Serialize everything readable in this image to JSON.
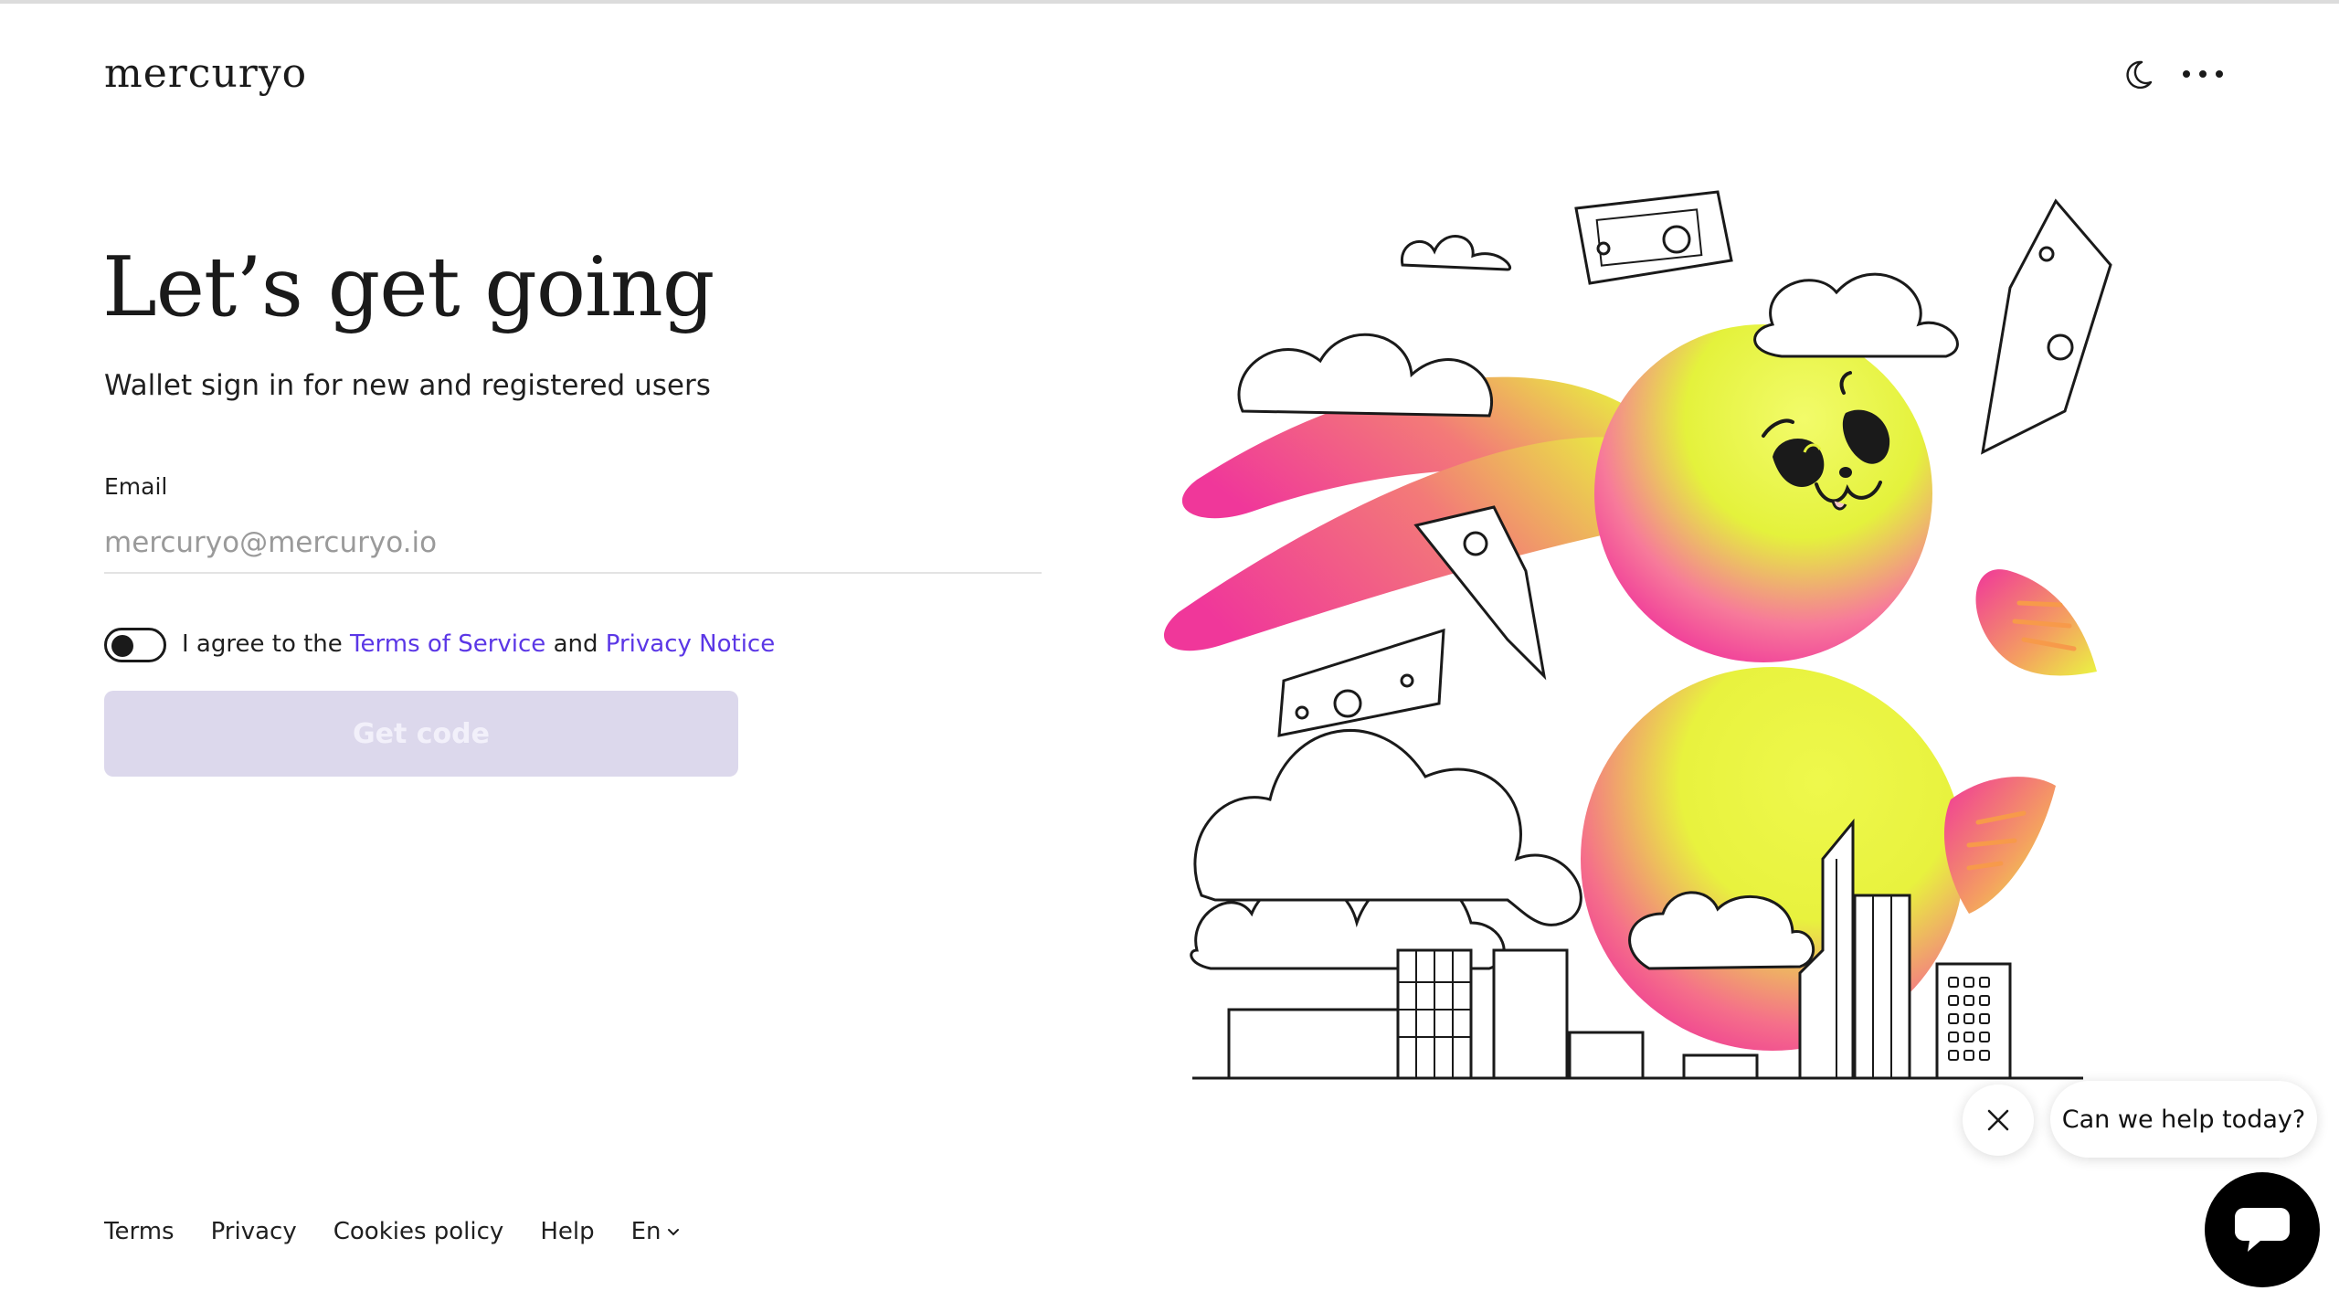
{
  "header": {
    "logo": "mercuryo",
    "theme_icon": "moon-icon",
    "menu_icon": "more-dots-icon"
  },
  "form": {
    "title": "Let’s get going",
    "subtitle": "Wallet sign in for new and registered users",
    "email_label": "Email",
    "email_placeholder": "mercuryo@mercuryo.io",
    "email_value": "",
    "agree_prefix": "I agree to the",
    "terms_link": "Terms of Service",
    "agree_and": "and",
    "privacy_link": "Privacy Notice",
    "consent_checked": false,
    "submit_label": "Get code"
  },
  "help": {
    "bubble_text": "Can we help today?",
    "close_icon": "close-icon",
    "chat_icon": "chat-bubble-icon"
  },
  "footer": {
    "links": [
      "Terms",
      "Privacy",
      "Cookies policy",
      "Help"
    ],
    "language": "En",
    "language_icon": "chevron-down-icon"
  },
  "colors": {
    "link": "#5b37e6",
    "button_disabled_bg": "#dcd8ec",
    "illustration_pink": "#f0379a",
    "illustration_yellow": "#eaf542"
  }
}
